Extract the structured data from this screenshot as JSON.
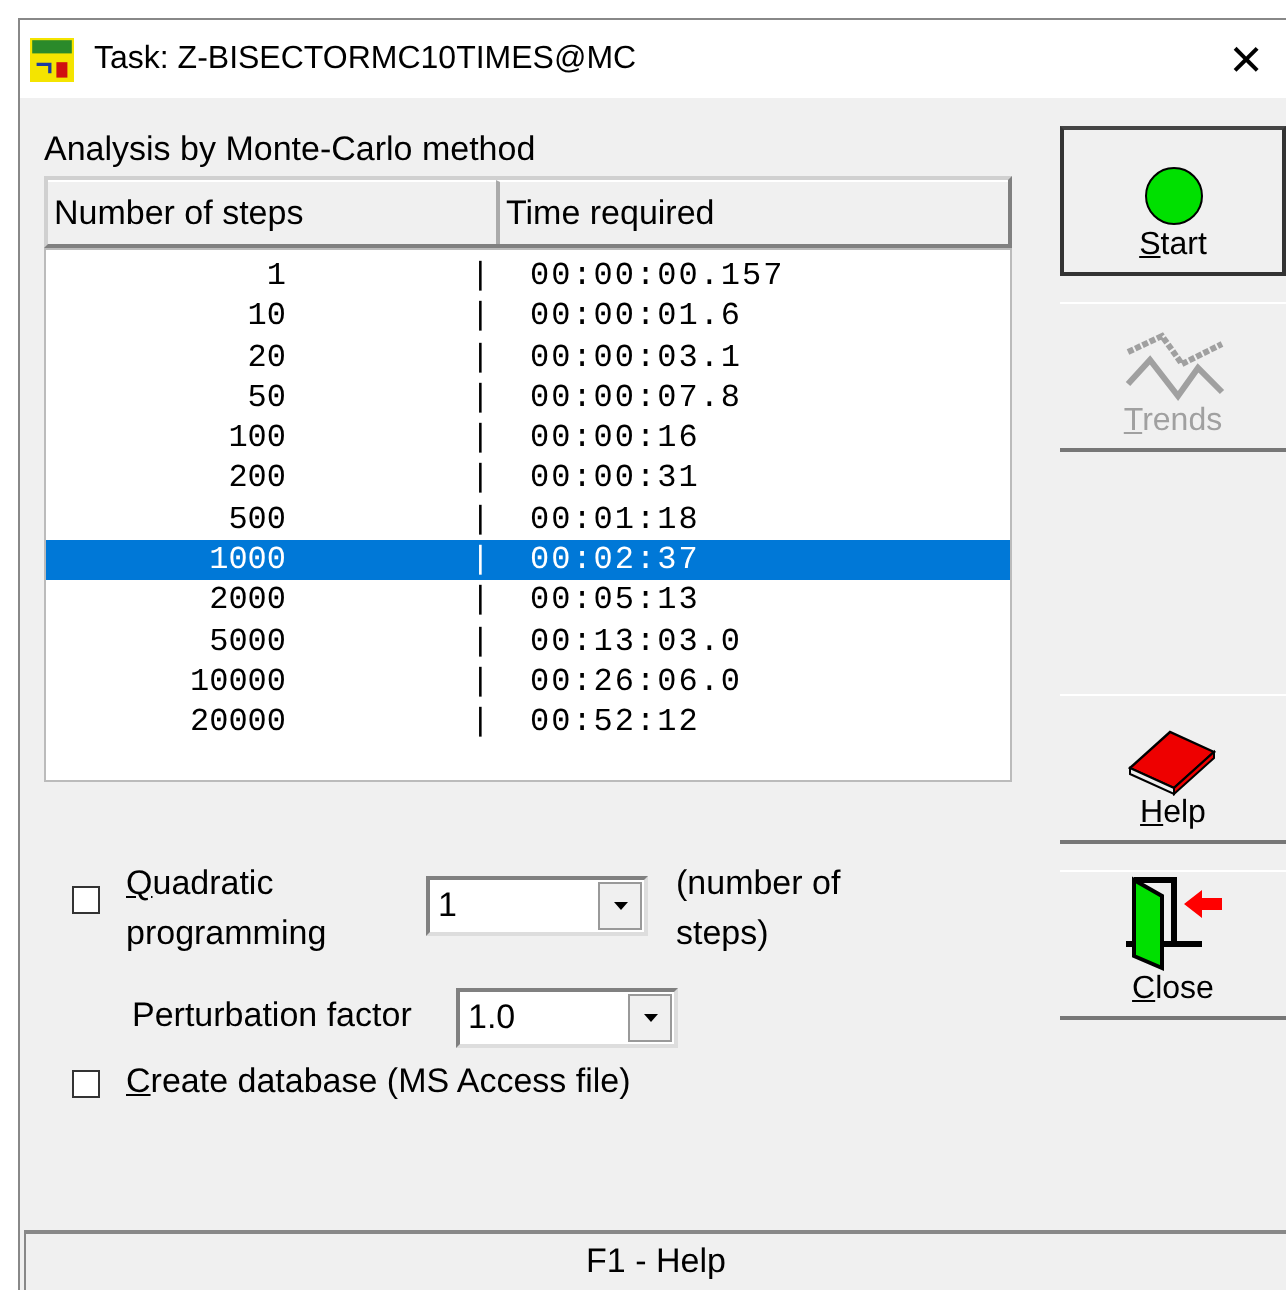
{
  "window": {
    "title": "Task: Z-BISECTORMC10TIMES@MC",
    "close": "×"
  },
  "group_label": "Analysis by Monte-Carlo method",
  "table": {
    "columns": [
      "Number of steps",
      "Time required"
    ],
    "rows": [
      {
        "steps": "1",
        "sep": "|",
        "time": "00:00:00.157",
        "selected": false
      },
      {
        "steps": "10",
        "sep": "|",
        "time": "00:00:01.6",
        "selected": false
      },
      {
        "steps": "20",
        "sep": "|",
        "time": "00:00:03.1",
        "selected": false
      },
      {
        "steps": "50",
        "sep": "|",
        "time": "00:00:07.8",
        "selected": false
      },
      {
        "steps": "100",
        "sep": "|",
        "time": "00:00:16",
        "selected": false
      },
      {
        "steps": "200",
        "sep": "|",
        "time": "00:00:31",
        "selected": false
      },
      {
        "steps": "500",
        "sep": "|",
        "time": "00:01:18",
        "selected": false
      },
      {
        "steps": "1000",
        "sep": "|",
        "time": "00:02:37",
        "selected": true
      },
      {
        "steps": "2000",
        "sep": "|",
        "time": "00:05:13",
        "selected": false
      },
      {
        "steps": "5000",
        "sep": "|",
        "time": "00:13:03.0",
        "selected": false
      },
      {
        "steps": "10000",
        "sep": "|",
        "time": "00:26:06.0",
        "selected": false
      },
      {
        "steps": "20000",
        "sep": "|",
        "time": "00:52:12",
        "selected": false
      }
    ]
  },
  "quadratic": {
    "label": "Quadratic programming",
    "checked": false,
    "steps_value": "1",
    "steps_note": "(number of steps)"
  },
  "perturbation": {
    "label": "Perturbation factor",
    "value": "1.0"
  },
  "database": {
    "label": "Create database (MS Access file)",
    "checked": false
  },
  "buttons": [
    {
      "kind": "start",
      "label": "Start",
      "disabled": false,
      "default": true
    },
    {
      "kind": "trends",
      "label": "Trends",
      "disabled": true,
      "default": false
    },
    {
      "kind": "help",
      "label": "Help",
      "disabled": false,
      "default": false
    },
    {
      "kind": "close",
      "label": "Close",
      "disabled": false,
      "default": false
    }
  ],
  "status_bar": "F1 - Help"
}
